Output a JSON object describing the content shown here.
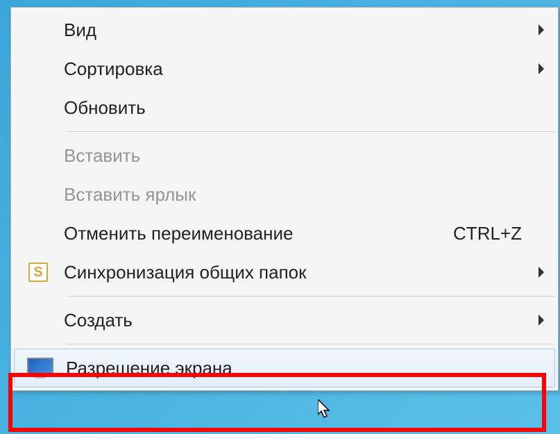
{
  "menu": {
    "items": [
      {
        "label": "Вид",
        "has_submenu": true,
        "disabled": false,
        "icon": null,
        "shortcut": null
      },
      {
        "label": "Сортировка",
        "has_submenu": true,
        "disabled": false,
        "icon": null,
        "shortcut": null
      },
      {
        "label": "Обновить",
        "has_submenu": false,
        "disabled": false,
        "icon": null,
        "shortcut": null
      },
      {
        "separator": true
      },
      {
        "label": "Вставить",
        "has_submenu": false,
        "disabled": true,
        "icon": null,
        "shortcut": null
      },
      {
        "label": "Вставить ярлык",
        "has_submenu": false,
        "disabled": true,
        "icon": null,
        "shortcut": null
      },
      {
        "label": "Отменить переименование",
        "has_submenu": false,
        "disabled": false,
        "icon": null,
        "shortcut": "CTRL+Z"
      },
      {
        "label": "Синхронизация общих папок",
        "has_submenu": true,
        "disabled": false,
        "icon": "sync",
        "shortcut": null
      },
      {
        "separator": true
      },
      {
        "label": "Создать",
        "has_submenu": true,
        "disabled": false,
        "icon": null,
        "shortcut": null
      },
      {
        "separator": true
      },
      {
        "label": "Разрешение экрана",
        "has_submenu": false,
        "disabled": false,
        "icon": "monitor",
        "shortcut": null,
        "highlighted": true,
        "hover": true
      }
    ]
  },
  "highlight": {
    "color": "#ff0000"
  }
}
